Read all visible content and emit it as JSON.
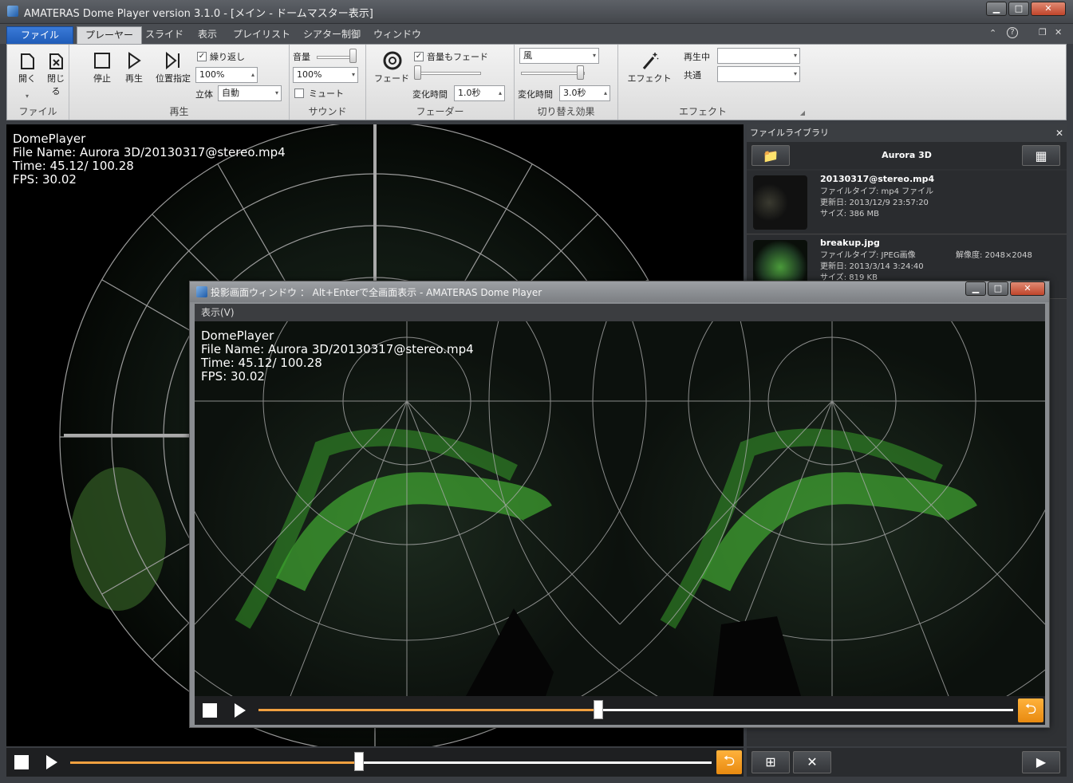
{
  "titlebar": {
    "title": "AMATERAS Dome Player version 3.1.0 - [メイン - ドームマスター表示]"
  },
  "menubar": {
    "file": "ファイル",
    "tabs": [
      "プレーヤー",
      "スライド",
      "表示",
      "プレイリスト",
      "シアター制御",
      "ウィンドウ"
    ],
    "help": "?"
  },
  "ribbon": {
    "file_group": {
      "label": "ファイル",
      "open": "開く",
      "close": "閉じる"
    },
    "play_group": {
      "label": "再生",
      "stop": "停止",
      "play": "再生",
      "seek": "位置指定",
      "repeat": "繰り返し",
      "speed": "100%",
      "stereo_label": "立体",
      "stereo_value": "自動"
    },
    "sound_group": {
      "label": "サウンド",
      "volume_label": "音量",
      "volume_value": "100%",
      "mute": "ミュート",
      "volume_level": 0.95
    },
    "fader_group": {
      "label": "フェーダー",
      "fade": "フェード",
      "fade_volume": "音量もフェード",
      "duration_label": "変化時間",
      "duration_value": "1.0秒"
    },
    "transition_group": {
      "label": "切り替え効果",
      "effect_value": "風",
      "duration_label": "変化時間",
      "duration_value": "3.0秒"
    },
    "effect_group": {
      "label": "エフェクト",
      "effect": "エフェクト",
      "playing_label": "再生中",
      "common_label": "共通"
    }
  },
  "overlay": {
    "line1": "DomePlayer",
    "line2": "File Name: Aurora 3D/20130317@stereo.mp4",
    "line3": "Time:   45.12/ 100.28",
    "line4": "FPS: 30.02"
  },
  "library": {
    "header": "ファイルライブラリ",
    "folder": "Aurora 3D",
    "items": [
      {
        "name": "20130317@stereo.mp4",
        "type": "ファイルタイプ: mp4 ファイル",
        "date": "更新日: 2013/12/9 23:57:20",
        "size": "サイズ: 386 MB"
      },
      {
        "name": "breakup.jpg",
        "type": "ファイルタイプ: JPEG画像",
        "resolution": "解像度: 2048×2048",
        "date": "更新日: 2013/3/14 3:24:40",
        "size": "サイズ: 819 KB"
      }
    ]
  },
  "projection_window": {
    "title": "投影画面ウィンドウ ： Alt+Enterで全画面表示 - AMATERAS Dome Player",
    "menu": "表示(V)"
  },
  "playback": {
    "progress": 0.45
  }
}
